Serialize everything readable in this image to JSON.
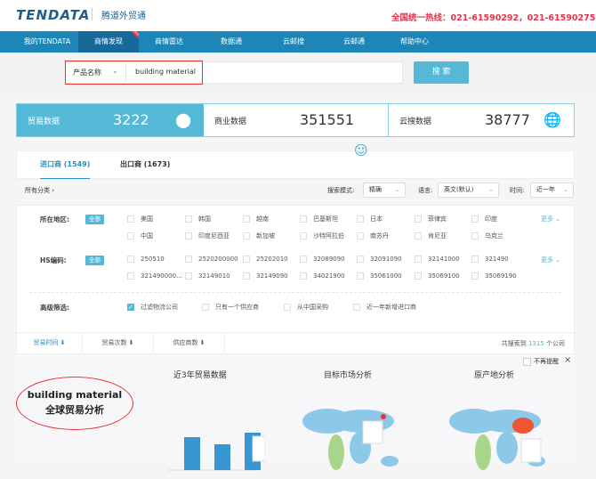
{
  "header": {
    "logo": "TENDATA",
    "subtitle": "腾道外贸通",
    "hotline": "全国统一热线：021-61590292，021-61590275"
  },
  "nav": {
    "items": [
      {
        "label": "我的TENDATA"
      },
      {
        "label": "商情发现",
        "badge": "NEW"
      },
      {
        "label": "商情雷达"
      },
      {
        "label": "数据通"
      },
      {
        "label": "云邮搜"
      },
      {
        "label": "云邮通"
      },
      {
        "label": "帮助中心"
      }
    ],
    "active": 1
  },
  "search": {
    "type": "产品名称",
    "value": "building material",
    "button": "搜 索"
  },
  "stats": [
    {
      "label": "贸易数据",
      "value": "3222",
      "icon": "bubbles-icon"
    },
    {
      "label": "商业数据",
      "value": "351551"
    },
    {
      "label": "云搜数据",
      "value": "38777",
      "icon": "globe-icon"
    }
  ],
  "tabs": [
    {
      "label": "进口商 (1549)"
    },
    {
      "label": "出口商 (1673)"
    }
  ],
  "filters_bar": {
    "category": "所有分类",
    "mode_label": "搜索模式:",
    "mode": "精确",
    "lang_label": "语言:",
    "lang": "英文(默认)",
    "time_label": "时间:",
    "time": "近一年"
  },
  "region": {
    "label": "所在地区:",
    "all": "全部",
    "more": "更多",
    "items": [
      "美国",
      "韩国",
      "越南",
      "巴基斯坦",
      "日本",
      "菲律宾",
      "印度",
      "中国",
      "印度尼西亚",
      "新加坡",
      "沙特阿拉伯",
      "南苏丹",
      "肯尼亚",
      "乌克兰"
    ]
  },
  "hs": {
    "label": "HS编码:",
    "all": "全部",
    "more": "更多",
    "items": [
      "250510",
      "2520200000",
      "25202010",
      "32089090",
      "32091090",
      "32141000",
      "321490",
      "321490000...",
      "32149010",
      "32149090",
      "34021900",
      "35061000",
      "35069100",
      "35069190"
    ]
  },
  "advanced": {
    "label": "高级筛选:",
    "items": [
      {
        "label": "过滤物流公司",
        "checked": true
      },
      {
        "label": "只有一个供应商",
        "checked": false
      },
      {
        "label": "从中国采购",
        "checked": false
      },
      {
        "label": "近一年新增进口商",
        "checked": false
      }
    ]
  },
  "sort": {
    "items": [
      "贸易时间 ⬇",
      "贸易次数 ⬇",
      "供应商数 ⬇"
    ],
    "result_prefix": "共搜索到",
    "result_count": "1315",
    "result_suffix": "个公司"
  },
  "promo": {
    "line1": "building material",
    "line2": "全球贸易分析",
    "titles": [
      "近3年贸易数据",
      "目标市场分析",
      "原产地分析"
    ],
    "dismiss": "不再提醒",
    "close": "×"
  },
  "colors": {
    "nav": "#1d86b6",
    "accent": "#54b9d7",
    "hotline": "#e8334a"
  }
}
